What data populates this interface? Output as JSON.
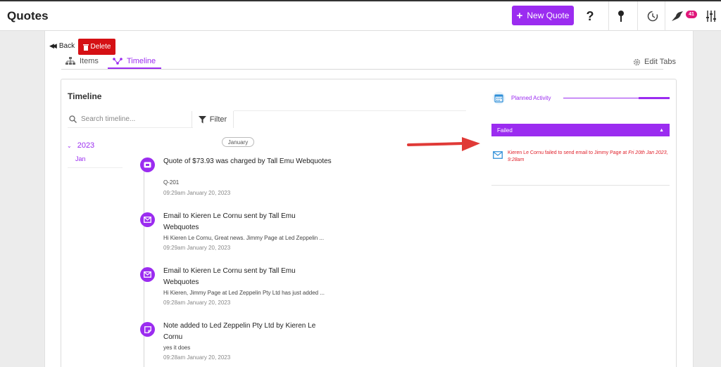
{
  "header": {
    "title": "Quotes",
    "new_quote_label": "New Quote",
    "help_glyph": "?",
    "notifications_count": "41",
    "icons": [
      "plus-icon",
      "help-icon",
      "pin-icon",
      "history-icon",
      "bird-icon",
      "sliders-icon"
    ]
  },
  "toolbar": {
    "back_label": "Back",
    "delete_label": "Delete"
  },
  "tabs": [
    {
      "label": "Items",
      "icon": "hierarchy-icon",
      "active": false
    },
    {
      "label": "Timeline",
      "icon": "timeline-icon",
      "active": true
    }
  ],
  "edit_tabs_label": "Edit Tabs",
  "timeline": {
    "title": "Timeline",
    "search_placeholder": "Search timeline...",
    "filter_label": "Filter",
    "year": "2023",
    "month": "Jan",
    "month_chip": "January",
    "entries": [
      {
        "icon": "ticket-icon",
        "title": "Quote of $73.93 was charged by Tall Emu Webquotes",
        "body": "Q-201",
        "time": "09:29am January 20, 2023"
      },
      {
        "icon": "mail-icon",
        "title": "Email to Kieren Le Cornu sent by Tall Emu Webquotes",
        "body": "Hi Kieren Le Cornu, Great news. Jimmy Page at Led Zeppelin ...",
        "time": "09:29am January 20, 2023"
      },
      {
        "icon": "mail-icon",
        "title": "Email to Kieren Le Cornu sent by Tall Emu Webquotes",
        "body": "Hi Kieren, Jimmy Page at Led Zeppelin Pty Ltd has just added ...",
        "time": "09:28am January 20, 2023"
      },
      {
        "icon": "note-icon",
        "title": "Note added to Led Zeppelin Pty Ltd by Kieren Le Cornu",
        "body": "yes it does",
        "time": "09:28am January 20, 2023"
      }
    ]
  },
  "planned_activity": {
    "label": "Planned Activity",
    "progress": 0.3
  },
  "failed": {
    "header": "Failed",
    "message": "Kieren Le Cornu failed to send email to Jimmy Page at ",
    "message_date": "Fri 20th Jan 2023, 9:28am"
  },
  "colors": {
    "accent": "#9b2cf0",
    "danger": "#d51014",
    "error_text": "#e0212b",
    "arrow": "#e03a37",
    "badge": "#e0187a"
  }
}
